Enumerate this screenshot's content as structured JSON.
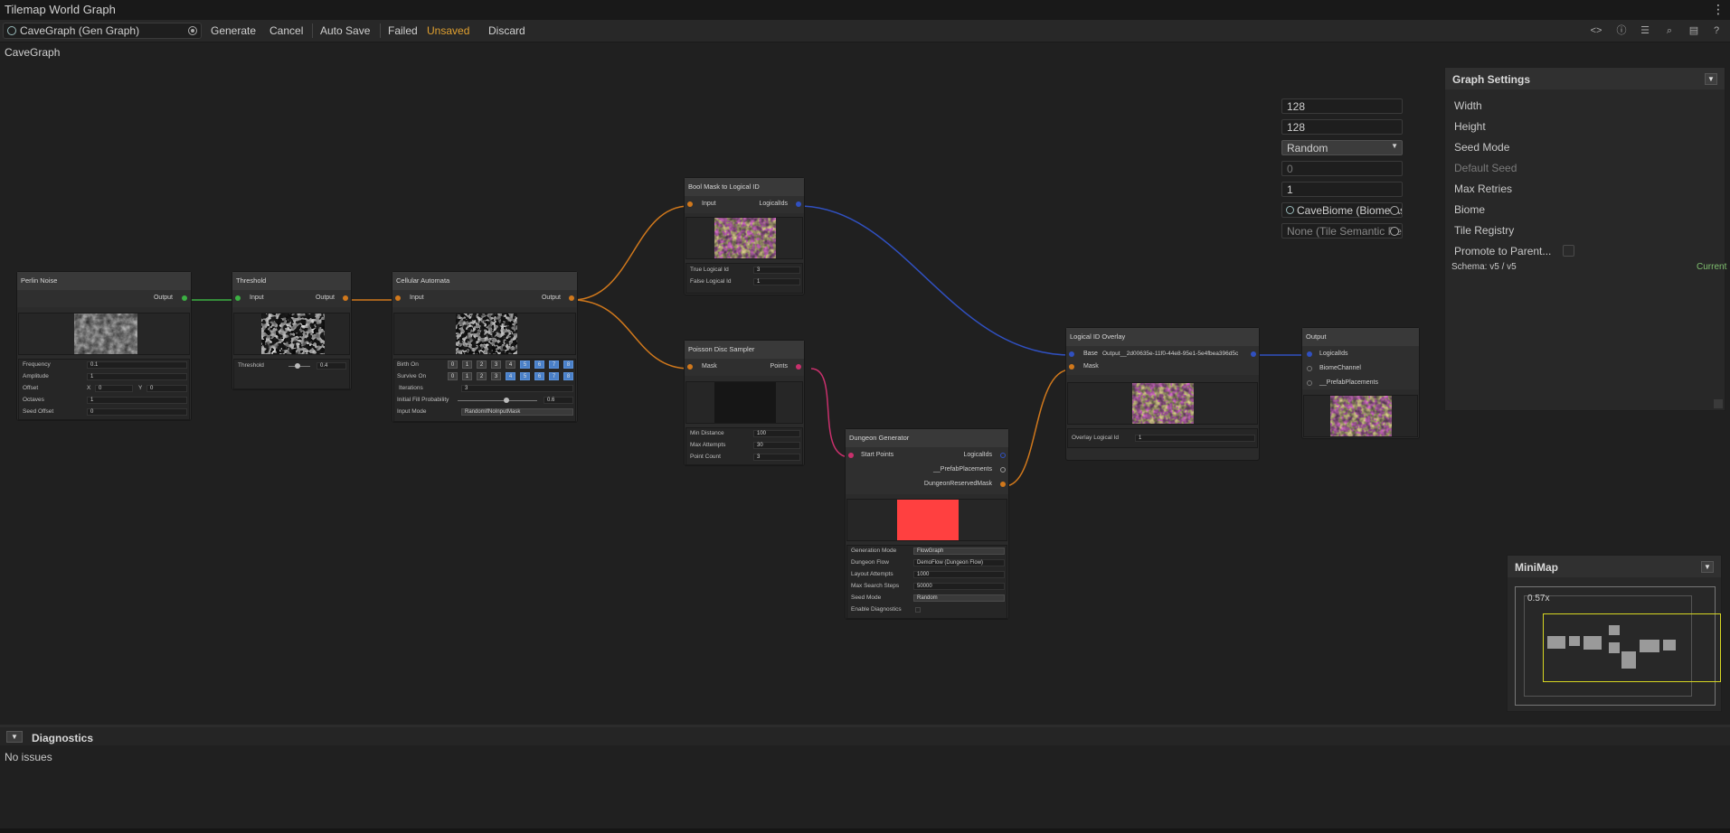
{
  "window": {
    "title": "Tilemap World Graph",
    "menu_icon": "kebab-menu-icon"
  },
  "toolbar": {
    "graph_field": "CaveGraph (Gen Graph)",
    "generate": "Generate",
    "cancel": "Cancel",
    "auto_save": "Auto Save",
    "failed": "Failed",
    "unsaved": "Unsaved",
    "discard": "Discard",
    "unsaved_color": "#e0a030",
    "right_icons": [
      "code-icon",
      "info-icon",
      "list-icon",
      "zoom-icon",
      "layout-icon",
      "help-icon"
    ]
  },
  "breadcrumb": "CaveGraph",
  "nodes": {
    "perlin": {
      "title": "Perlin Noise",
      "output": "Output",
      "frequency_label": "Frequency",
      "frequency": "0.1",
      "amplitude_label": "Amplitude",
      "amplitude": "1",
      "offset_label": "Offset",
      "offset_x_label": "X",
      "offset_x": "0",
      "offset_y_label": "Y",
      "offset_y": "0",
      "octaves_label": "Octaves",
      "octaves": "1",
      "seed_offset_label": "Seed Offset",
      "seed_offset": "0"
    },
    "threshold": {
      "title": "Threshold",
      "input": "Input",
      "output": "Output",
      "threshold_label": "Threshold",
      "threshold": "0.4"
    },
    "cellular": {
      "title": "Cellular Automata",
      "input": "Input",
      "output": "Output",
      "birth_label": "Birth On",
      "survive_label": "Survive On",
      "digits": [
        "0",
        "1",
        "2",
        "3",
        "4",
        "5",
        "6",
        "7",
        "8"
      ],
      "iterations_label": "Iterations",
      "iterations": "3",
      "fill_label": "Initial Fill Probability",
      "fill": "0.6",
      "input_mode_label": "Input Mode",
      "input_mode": "RandomIfNoInputMask"
    },
    "boolmask": {
      "title": "Bool Mask to Logical ID",
      "input": "Input",
      "output": "LogicalIds",
      "true_label": "True Logical Id",
      "true_val": "3",
      "false_label": "False Logical Id",
      "false_val": "1"
    },
    "poisson": {
      "title": "Poisson Disc Sampler",
      "input": "Mask",
      "output": "Points",
      "min_label": "Min Distance",
      "min_val": "100",
      "max_label": "Max Attempts",
      "max_val": "30",
      "count_label": "Point Count",
      "count_val": "3"
    },
    "dungeon": {
      "title": "Dungeon Generator",
      "input": "Start Points",
      "out1": "LogicalIds",
      "out2": "__PrefabPlacements",
      "out3": "DungeonReservedMask",
      "mode_label": "Generation Mode",
      "mode": "FlowGraph",
      "flow_label": "Dungeon Flow",
      "flow": "DemoFlow (Dungeon Flow)",
      "layout_label": "Layout Attempts",
      "layout": "1000",
      "search_label": "Max Search Steps",
      "search": "50000",
      "seed_label": "Seed Mode",
      "seed": "Random",
      "diag_label": "Enable Diagnostics"
    },
    "overlay": {
      "title": "Logical ID Overlay",
      "base": "Base",
      "mask": "Mask",
      "output": "Output__2d00635e-11f0-44e8-95e1-5e4fbea396d5c",
      "overlay_label": "Overlay Logical Id",
      "overlay_val": "1"
    },
    "output": {
      "title": "Output",
      "in1": "LogicalIds",
      "in2": "BiomeChannel",
      "in3": "__PrefabPlacements"
    }
  },
  "graph_settings": {
    "title": "Graph Settings",
    "width_label": "Width",
    "width": "128",
    "height_label": "Height",
    "height": "128",
    "seed_mode_label": "Seed Mode",
    "seed_mode": "Random",
    "default_seed_label": "Default Seed",
    "default_seed": "0",
    "max_retries_label": "Max Retries",
    "max_retries": "1",
    "biome_label": "Biome",
    "biome": "CaveBiome (Biome Ass",
    "tile_registry_label": "Tile Registry",
    "tile_registry": "None (Tile Semantic Regi",
    "promote_label": "Promote to Parent...",
    "schema": "Schema: v5 / v5",
    "schema_status": "Current",
    "schema_status_color": "#7fbf6f"
  },
  "minimap": {
    "title": "MiniMap",
    "zoom": "0.57x"
  },
  "diagnostics": {
    "title": "Diagnostics",
    "status": "No issues"
  },
  "colors": {
    "wire_green": "#3cb043",
    "wire_orange": "#d0781c",
    "wire_blue": "#3050c0",
    "wire_pink": "#c8306c",
    "preview_red": "#ff4040"
  }
}
